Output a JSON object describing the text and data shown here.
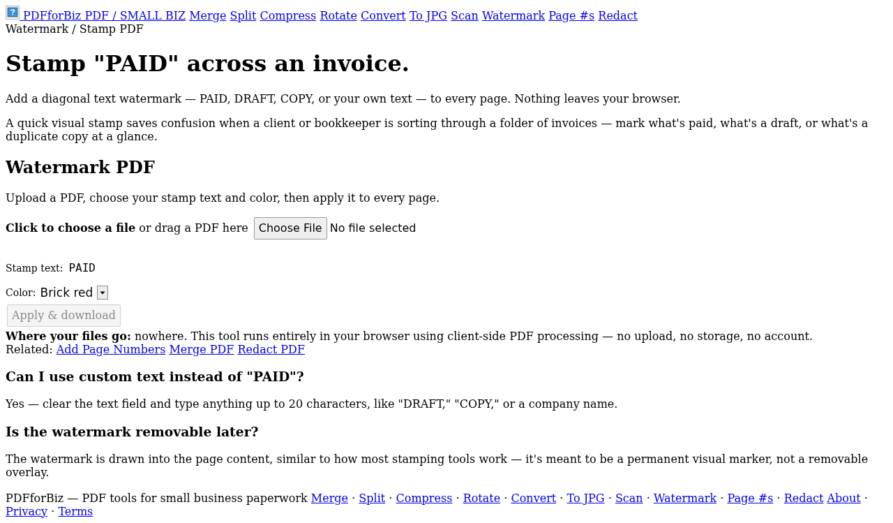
{
  "nav": {
    "brand": "PDFforBiz PDF / SMALL BIZ",
    "links": [
      "Merge",
      "Split",
      "Compress",
      "Rotate",
      "Convert",
      "To JPG",
      "Scan",
      "Watermark",
      "Page #s",
      "Redact"
    ]
  },
  "breadcrumb": "Watermark / Stamp PDF",
  "title": "Stamp \"PAID\" across an invoice.",
  "intro": [
    "Add a diagonal text watermark — PAID, DRAFT, COPY, or your own text — to every page. Nothing leaves your browser.",
    "A quick visual stamp saves confusion when a client or bookkeeper is sorting through a folder of invoices — mark what's paid, what's a draft, or what's a duplicate copy at a glance."
  ],
  "tool": {
    "heading": "Watermark PDF",
    "description": "Upload a PDF, choose your stamp text and color, then apply it to every page.",
    "file_picker": {
      "label": "**Click to choose a file** or drag a PDF here",
      "button": "Choose File",
      "status": "No file selected"
    },
    "stamp_text": {
      "label": "Stamp text:",
      "value": "PAID"
    },
    "color": {
      "label": "Color:",
      "value": "Brick red"
    },
    "apply_button": {
      "label": "Apply & download",
      "disabled": true
    }
  },
  "privacy_note": "**Where your files go:** nowhere. This tool runs entirely in your browser using client-side PDF processing — no upload, no storage, no account.",
  "related": {
    "label": "Related:",
    "links": [
      "Add Page Numbers",
      "Merge PDF",
      "Redact PDF"
    ]
  },
  "faq": [
    {
      "question": "Can I use custom text instead of \"PAID\"?",
      "answer": "Yes — clear the text field and type anything up to 20 characters, like \"DRAFT,\" \"COPY,\" or a company name."
    },
    {
      "question": "Is the watermark removable later?",
      "answer": "The watermark is drawn into the page content, similar to how most stamping tools work — it's meant to be a permanent visual marker, not a removable overlay."
    }
  ],
  "footer": {
    "items": [
      {
        "kind": "text",
        "text": "PDFforBiz — PDF tools for small business paperwork"
      },
      {
        "kind": "link",
        "text": "Merge"
      },
      {
        "kind": "separator",
        "text": "·"
      },
      {
        "kind": "link",
        "text": "Split"
      },
      {
        "kind": "separator",
        "text": "·"
      },
      {
        "kind": "link",
        "text": "Compress"
      },
      {
        "kind": "separator",
        "text": "·"
      },
      {
        "kind": "link",
        "text": "Rotate"
      },
      {
        "kind": "separator",
        "text": "·"
      },
      {
        "kind": "link",
        "text": "Convert"
      },
      {
        "kind": "separator",
        "text": "·"
      },
      {
        "kind": "link",
        "text": "To JPG"
      },
      {
        "kind": "separator",
        "text": "·"
      },
      {
        "kind": "link",
        "text": "Scan"
      },
      {
        "kind": "separator",
        "text": "·"
      },
      {
        "kind": "link",
        "text": "Watermark"
      },
      {
        "kind": "separator",
        "text": "·"
      },
      {
        "kind": "link",
        "text": "Page #s"
      },
      {
        "kind": "separator",
        "text": "·"
      },
      {
        "kind": "link",
        "text": "Redact"
      },
      {
        "kind": "link",
        "text": "About"
      },
      {
        "kind": "separator",
        "text": "·"
      },
      {
        "kind": "link",
        "text": "Privacy"
      },
      {
        "kind": "separator",
        "text": "·"
      },
      {
        "kind": "link",
        "text": "Terms"
      }
    ]
  }
}
